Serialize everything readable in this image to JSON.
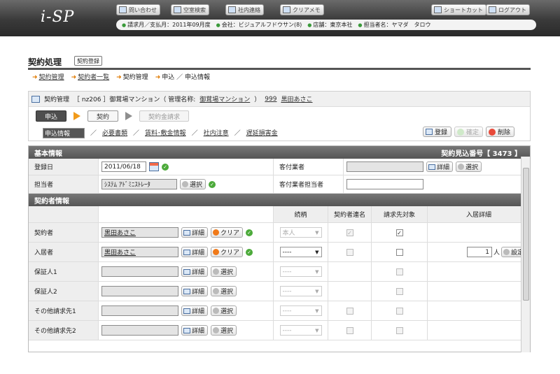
{
  "app": {
    "logo": "i-SP"
  },
  "header": {
    "buttons": [
      "問い合わせ",
      "空室検索",
      "社内連絡",
      "クリアメモ"
    ],
    "right_buttons": [
      "ショートカット",
      "ログアウト"
    ],
    "info": {
      "period": "請求月／支払月：2011年09月度",
      "company": "会社：ビジュアルフドウサン(8)",
      "store": "店舗：東京本社",
      "staff": "担当者名：ヤマダ　タロウ"
    }
  },
  "page": {
    "title": "契約処理",
    "tag": "契約登録"
  },
  "breadcrumb": [
    "契約管理",
    "契約者一覧",
    "契約管理",
    "申込 ／ 申込情報"
  ],
  "contract": {
    "prefix": "契約管理",
    "code": "［ nz206 ］御茸場マンション（ 管理名称:",
    "link_name": "御茸場マンション",
    "room": "999",
    "person": "黒田あさこ"
  },
  "steps": [
    "申込",
    "契約",
    "契約金請求"
  ],
  "subtabs": [
    "申込情報",
    "必要書類",
    "賃料･敷金情報",
    "社内注意",
    "遅延損害金"
  ],
  "actions": {
    "register": "登録",
    "confirm": "確定",
    "delete": "削除"
  },
  "basic": {
    "header": "基本情報",
    "contract_no": "契約見込番号【 3473 】",
    "reg_date_label": "登録日",
    "reg_date": "2011/06/18",
    "agent_label": "客付業者",
    "detail": "詳細",
    "select": "選択",
    "staff_label": "担当者",
    "staff_value": "ｼｽﾃﾑ ｱﾄﾞﾐﾆｽﾄﾚｰﾀ",
    "agent_staff_label": "客付業者担当者"
  },
  "parties": {
    "header": "契約者情報",
    "cols": [
      "続柄",
      "契約者連名",
      "請求先対象",
      "入居詳細"
    ],
    "clear": "クリア",
    "rows": [
      {
        "label": "契約者",
        "name": "黒田あさこ",
        "rel": "本人"
      },
      {
        "label": "入居者",
        "name": "黒田あさこ",
        "rel": "----",
        "count": "1",
        "unit": "人",
        "set": "設定"
      },
      {
        "label": "保証人1",
        "name": "",
        "rel": "----"
      },
      {
        "label": "保証人2",
        "name": "",
        "rel": "----"
      },
      {
        "label": "その他請求先1",
        "name": "",
        "rel": "----"
      },
      {
        "label": "その他請求先2",
        "name": "",
        "rel": "----"
      }
    ]
  }
}
